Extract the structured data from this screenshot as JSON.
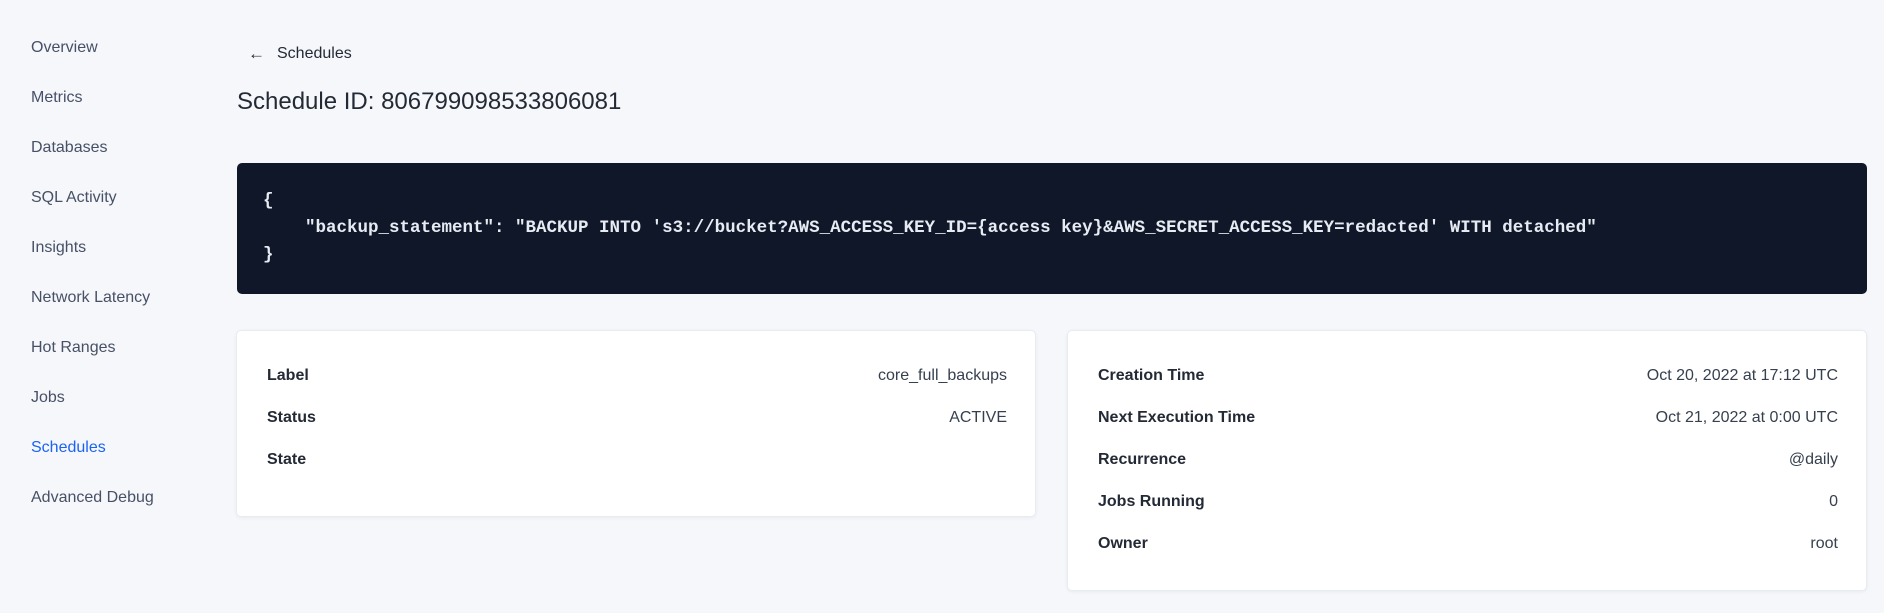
{
  "sidebar": {
    "active_item": "Schedules",
    "items": [
      {
        "label": "Overview"
      },
      {
        "label": "Metrics"
      },
      {
        "label": "Databases"
      },
      {
        "label": "SQL Activity"
      },
      {
        "label": "Insights"
      },
      {
        "label": "Network Latency"
      },
      {
        "label": "Hot Ranges"
      },
      {
        "label": "Jobs"
      },
      {
        "label": "Schedules"
      },
      {
        "label": "Advanced Debug"
      }
    ]
  },
  "header": {
    "back_label": "Schedules",
    "title": "Schedule ID: 806799098533806081"
  },
  "icons": {
    "back_arrow": "←"
  },
  "code_block": {
    "text": "{\n    \"backup_statement\": \"BACKUP INTO 's3://bucket?AWS_ACCESS_KEY_ID={access key}&AWS_SECRET_ACCESS_KEY=redacted' WITH detached\"\n}"
  },
  "details_card": {
    "rows": [
      {
        "label": "Label",
        "value": "core_full_backups"
      },
      {
        "label": "Status",
        "value": "ACTIVE"
      },
      {
        "label": "State",
        "value": ""
      }
    ]
  },
  "schedule_card": {
    "rows": [
      {
        "label": "Creation Time",
        "value": "Oct 20, 2022 at 17:12 UTC"
      },
      {
        "label": "Next Execution Time",
        "value": "Oct 21, 2022 at 0:00 UTC"
      },
      {
        "label": "Recurrence",
        "value": "@daily"
      },
      {
        "label": "Jobs Running",
        "value": "0"
      },
      {
        "label": "Owner",
        "value": "root"
      }
    ]
  },
  "colors": {
    "background": "#f5f7fa",
    "code_background": "#0f1729",
    "code_text": "#e7ecf3",
    "active_link": "#1c63f2",
    "sidebar_text": "#475066",
    "heading_text": "#242a35",
    "card_border": "#e7ecf3"
  }
}
